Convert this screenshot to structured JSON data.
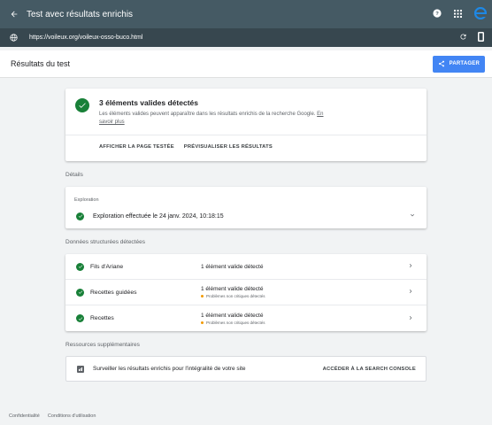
{
  "topbar": {
    "title": "Test avec résultats enrichis"
  },
  "urlbar": {
    "url": "https://voileux.org/voileux-osso-buco.html"
  },
  "header": {
    "title": "Résultats du test",
    "share_label": "PARTAGER"
  },
  "summary": {
    "title": "3 éléments valides détectés",
    "description": "Les éléments valides peuvent apparaître dans les résultats enrichis de la recherche Google.",
    "learn_more": "En savoir plus",
    "action_view": "AFFICHER LA PAGE TESTÉE",
    "action_preview": "PRÉVISUALISER LES RÉSULTATS"
  },
  "details": {
    "section_label": "Détails",
    "card_head": "Exploration",
    "row_label": "Exploration effectuée le 24 janv. 2024, 10:18:15"
  },
  "structured": {
    "section_label": "Données structurées détectées",
    "rows": [
      {
        "name": "Fils d'Ariane",
        "status": "1 élément valide détecté",
        "warning": ""
      },
      {
        "name": "Recettes guidées",
        "status": "1 élément valide détecté",
        "warning": "Problèmes non critiques détectés"
      },
      {
        "name": "Recettes",
        "status": "1 élément valide détecté",
        "warning": "Problèmes non critiques détectés"
      }
    ]
  },
  "resources": {
    "section_label": "Ressources supplémentaires",
    "text": "Surveiller les résultats enrichis pour l'intégralité de votre site",
    "link": "ACCÉDER À LA SEARCH CONSOLE"
  },
  "footer": {
    "privacy": "Confidentialité",
    "terms": "Conditions d'utilisation"
  },
  "colors": {
    "topbar": "#455a64",
    "urlbar": "#37474f",
    "accent": "#4285f4",
    "success": "#188038",
    "warning": "#f29900"
  },
  "icons": [
    "back-arrow-icon",
    "help-icon",
    "apps-grid-icon",
    "browser-logo-icon",
    "globe-icon",
    "reload-icon",
    "device-icon",
    "share-icon",
    "check-icon",
    "chevron-down-icon",
    "chevron-right-icon",
    "search-console-icon"
  ]
}
